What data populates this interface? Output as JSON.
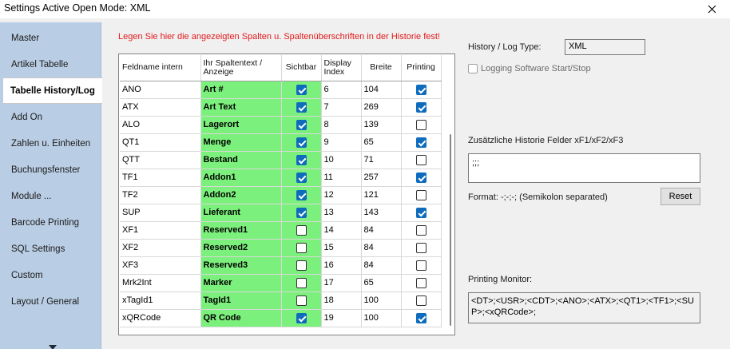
{
  "window": {
    "title": "Settings Active Open Mode: XML"
  },
  "sidebar": {
    "items": [
      {
        "label": "Master"
      },
      {
        "label": "Artikel Tabelle"
      },
      {
        "label": "Tabelle History/Log",
        "active": true
      },
      {
        "label": "Add On"
      },
      {
        "label": "Zahlen u. Einheiten"
      },
      {
        "label": "Buchungsfenster"
      },
      {
        "label": "Module ..."
      },
      {
        "label": "Barcode Printing"
      },
      {
        "label": "SQL Settings"
      },
      {
        "label": "Custom"
      },
      {
        "label": "Layout / General"
      }
    ]
  },
  "main": {
    "info": "Legen Sie hier die angezeigten Spalten u. Spaltenüberschriften in der Historie fest!",
    "grid": {
      "columns": {
        "feldname": "Feldname intern",
        "spaltentext": "Ihr Spaltentext / Anzeige",
        "sichtbar": "Sichtbar",
        "display_index": "Display Index",
        "breite": "Breite",
        "printing": "Printing"
      },
      "rows": [
        {
          "feld": "ANO",
          "text": "Art #",
          "sichtbar": true,
          "index": "6",
          "breite": "104",
          "printing": true
        },
        {
          "feld": "ATX",
          "text": "Art Text",
          "sichtbar": true,
          "index": "7",
          "breite": "269",
          "printing": true
        },
        {
          "feld": "ALO",
          "text": "Lagerort",
          "sichtbar": true,
          "index": "8",
          "breite": "139",
          "printing": false
        },
        {
          "feld": "QT1",
          "text": "Menge",
          "sichtbar": true,
          "index": "9",
          "breite": "65",
          "printing": true
        },
        {
          "feld": "QTT",
          "text": "Bestand",
          "sichtbar": true,
          "index": "10",
          "breite": "71",
          "printing": false
        },
        {
          "feld": "TF1",
          "text": "Addon1",
          "sichtbar": true,
          "index": "11",
          "breite": "257",
          "printing": true
        },
        {
          "feld": "TF2",
          "text": "Addon2",
          "sichtbar": true,
          "index": "12",
          "breite": "121",
          "printing": false
        },
        {
          "feld": "SUP",
          "text": "Lieferant",
          "sichtbar": true,
          "index": "13",
          "breite": "143",
          "printing": true
        },
        {
          "feld": "XF1",
          "text": "Reserved1",
          "sichtbar": false,
          "index": "14",
          "breite": "84",
          "printing": false
        },
        {
          "feld": "XF2",
          "text": "Reserved2",
          "sichtbar": false,
          "index": "15",
          "breite": "84",
          "printing": false
        },
        {
          "feld": "XF3",
          "text": "Reserved3",
          "sichtbar": false,
          "index": "16",
          "breite": "84",
          "printing": false
        },
        {
          "feld": "Mrk2Int",
          "text": "Marker",
          "sichtbar": false,
          "index": "17",
          "breite": "65",
          "printing": false
        },
        {
          "feld": "xTagId1",
          "text": "TagId1",
          "sichtbar": false,
          "index": "18",
          "breite": "100",
          "printing": false
        },
        {
          "feld": "xQRCode",
          "text": "QR Code",
          "sichtbar": true,
          "index": "19",
          "breite": "100",
          "printing": true
        }
      ]
    }
  },
  "right": {
    "log_type_label": "History / Log Type:",
    "log_type_value": "XML",
    "logging_label": "Logging Software Start/Stop",
    "logging_checked": false,
    "extra_label": "Zusätzliche Historie Felder xF1/xF2/xF3",
    "extra_value": ";;;",
    "format_label": "Format: -;-;-; (Semikolon separated)",
    "reset_label": "Reset",
    "monitor_label": "Printing Monitor:",
    "monitor_value": "<DT>;<USR>;<CDT>;<ANO>;<ATX>;<QT1>;<TF1>;<SUP>;<xQRCode>;"
  },
  "colors": {
    "sidebar_bg": "#b9cde4",
    "highlight_green": "#7cf07c",
    "checkbox_blue": "#0f6cbd",
    "info_red": "#e21a1a"
  }
}
